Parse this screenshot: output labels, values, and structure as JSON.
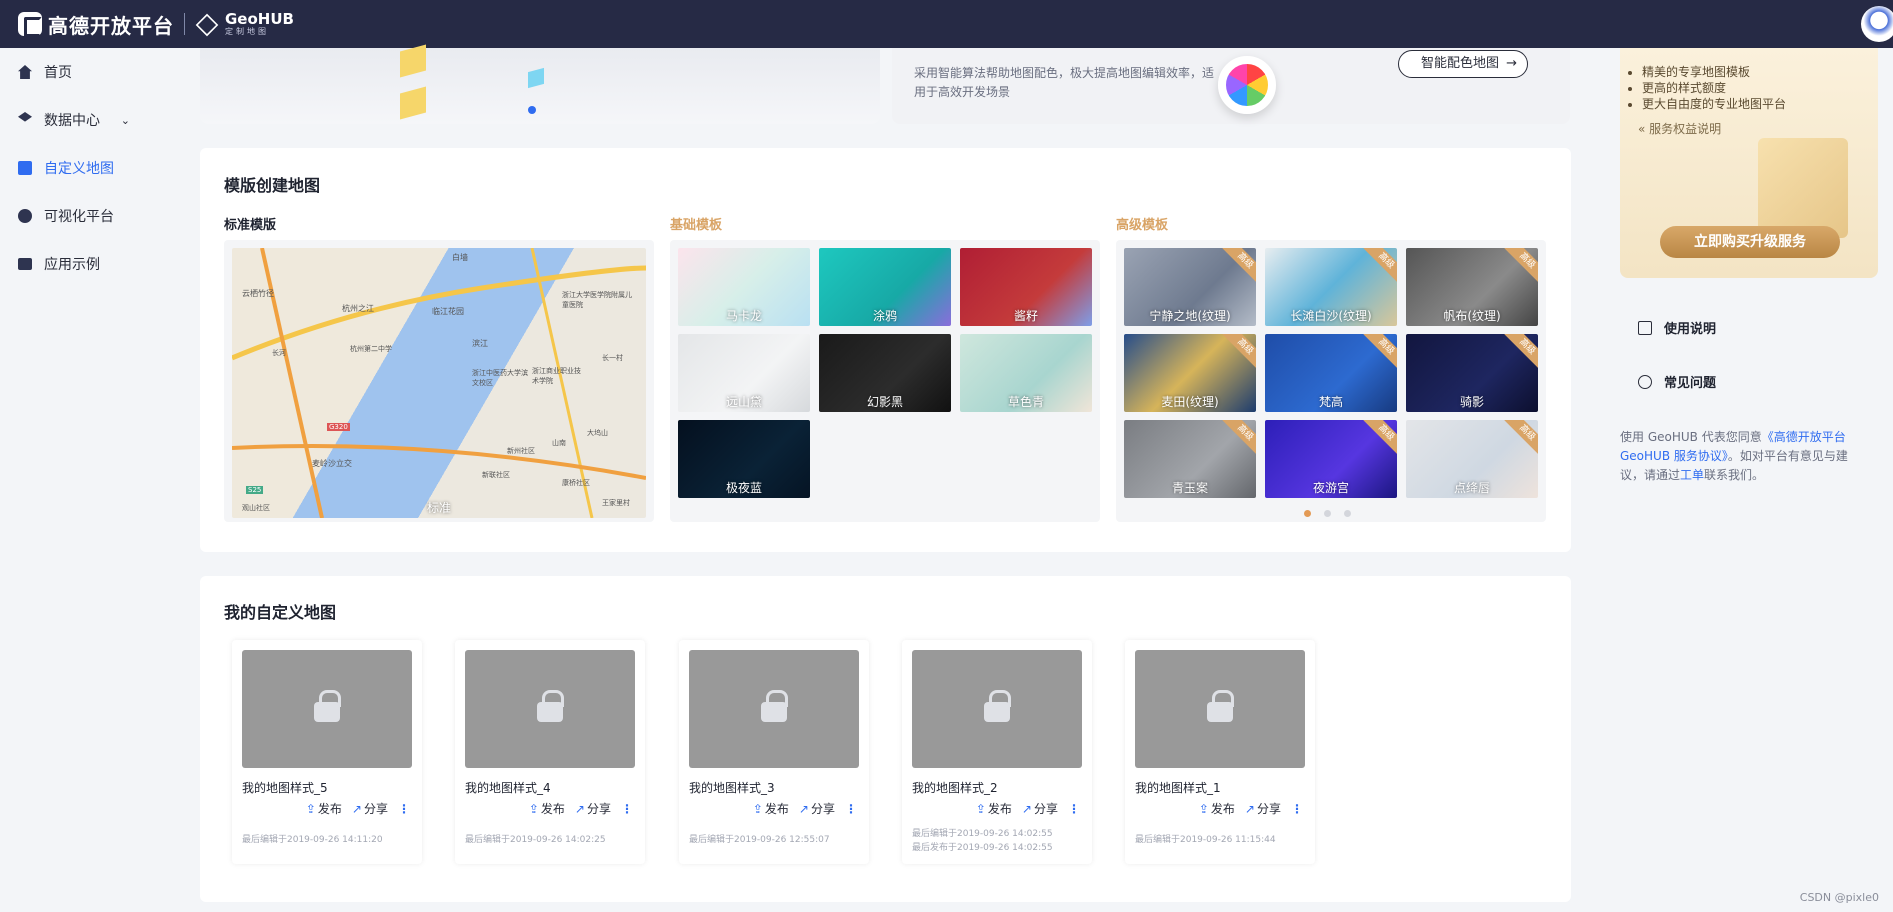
{
  "header": {
    "brand": "高德开放平台",
    "geohub": "GeoHUB",
    "geohub_sub": "定制地图"
  },
  "sidebar": {
    "items": [
      {
        "label": "首页",
        "icon": "home-icon"
      },
      {
        "label": "数据中心",
        "icon": "layers-icon",
        "expand": "⌄"
      },
      {
        "label": "自定义地图",
        "icon": "map-icon"
      },
      {
        "label": "可视化平台",
        "icon": "share-nodes-icon"
      },
      {
        "label": "应用示例",
        "icon": "monitor-icon"
      }
    ]
  },
  "banner": {
    "desc": "采用智能算法帮助地图配色，极大提高地图编辑效率，适用于高效开发场景",
    "smart_button": "智能配色地图",
    "arrow": "→"
  },
  "templates": {
    "title": "模版创建地图",
    "standard_label": "标准模版",
    "basic_label": "基础模板",
    "advanced_label": "高级模板",
    "standard_tile": "标准",
    "standard_map_labels": [
      "白墙",
      "云栖竹径",
      "杭州之江",
      "浙江大学医学院附属儿童医院",
      "临江花园",
      "滨江",
      "杭州第二中学",
      "浙江中医药大学滨文校区",
      "浙江商业职业技术学院",
      "长一村",
      "G320",
      "麦岭沙立交",
      "新州社区",
      "山南",
      "大坞山",
      "王家里村",
      "S25",
      "长河",
      "观山社区",
      "新联社区",
      "康桥社区"
    ],
    "basic_tiles": [
      "马卡龙",
      "涂鸦",
      "酱籽",
      "远山黛",
      "幻影黑",
      "草色青",
      "极夜蓝"
    ],
    "advanced_tiles": [
      "宁静之地(纹理)",
      "长滩白沙(纹理)",
      "帆布(纹理)",
      "麦田(纹理)",
      "梵高",
      "骑影",
      "青玉案",
      "夜游宫",
      "点绛唇"
    ],
    "advanced_tag": "高级"
  },
  "my_maps": {
    "title": "我的自定义地图",
    "publish": "发布",
    "share": "分享",
    "more": "⋮",
    "items": [
      {
        "name": "我的地图样式_5",
        "edited": "最后编辑于2019-09-26 14:11:20",
        "published": ""
      },
      {
        "name": "我的地图样式_4",
        "edited": "最后编辑于2019-09-26 14:02:25",
        "published": ""
      },
      {
        "name": "我的地图样式_3",
        "edited": "最后编辑于2019-09-26 12:55:07",
        "published": ""
      },
      {
        "name": "我的地图样式_2",
        "edited": "最后编辑于2019-09-26 14:02:55",
        "published": "最后发布于2019-09-26 14:02:55"
      },
      {
        "name": "我的地图样式_1",
        "edited": "最后编辑于2019-09-26 11:15:44",
        "published": ""
      }
    ]
  },
  "promo": {
    "features": [
      "精美的专享地图模板",
      "更高的样式额度",
      "更大自由度的专业地图平台"
    ],
    "benefits_link": "服务权益说明",
    "buy_button": "立即购买升级服务"
  },
  "help": {
    "usage": "使用说明",
    "faq": "常见问题"
  },
  "agreement": {
    "prefix": "使用 GeoHUB 代表您同意",
    "link": "《高德开放平台 GeoHUB 服务协议》",
    "middle": "。如对平台有意见与建议，请通过",
    "ticket": "工单",
    "suffix": "联系我们。"
  },
  "watermark": "CSDN @pixle0",
  "colors": {
    "accent": "#2f6cf0",
    "topbar": "#262a45",
    "gold": "#d9a466"
  }
}
